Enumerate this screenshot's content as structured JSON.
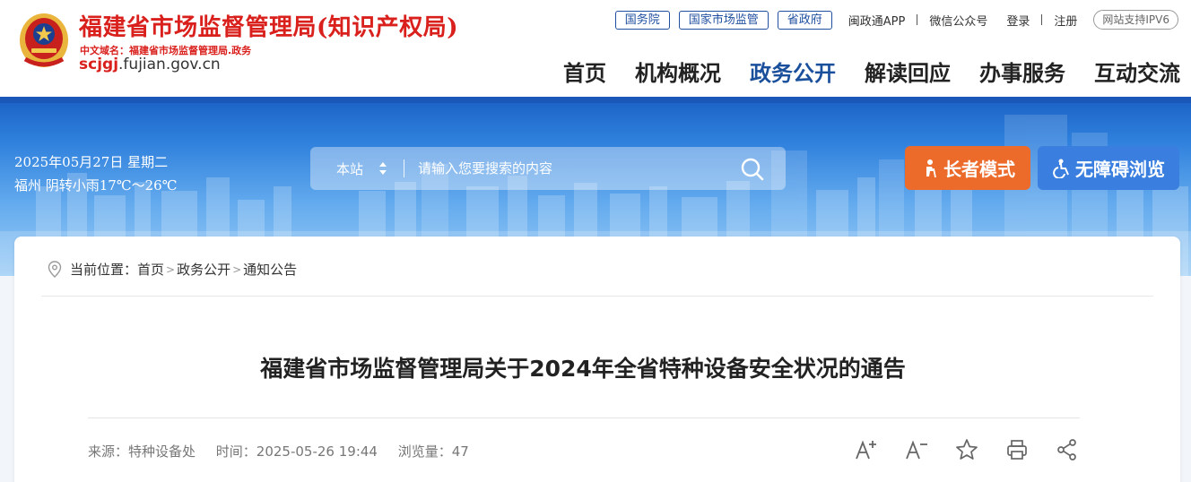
{
  "site": {
    "title": "福建省市场监督管理局(知识产权局)",
    "domain_cn": "中文域名：福建省市场监督管理局.政务",
    "domain_en_bold": "scjgj",
    "domain_en_rest": ".fujian.gov.cn"
  },
  "toplinks": {
    "tags": [
      "国务院",
      "国家市场监管",
      "省政府"
    ],
    "app": "闽政通APP",
    "wechat": "微信公众号",
    "login": "登录",
    "register": "注册",
    "ipv6": "网站支持IPV6"
  },
  "nav": {
    "items": [
      "首页",
      "机构概况",
      "政务公开",
      "解读回应",
      "办事服务",
      "互动交流"
    ],
    "active": "政务公开"
  },
  "banner": {
    "date": "2025年05月27日 星期二",
    "weather": "福州 阴转小雨17℃～26℃",
    "search_scope": "本站",
    "search_placeholder": "请输入您要搜索的内容",
    "elder_mode": "长者模式",
    "accessible": "无障碍浏览"
  },
  "colors": {
    "brand_red": "#d9201c",
    "nav_active": "#1a4f9c",
    "elder_orange": "#ec6a2a",
    "access_blue": "#3a7fe0"
  },
  "breadcrumb": {
    "prefix": "当前位置：",
    "items": [
      "首页",
      "政务公开",
      "通知公告"
    ],
    "separator": ">"
  },
  "article": {
    "title": "福建省市场监督管理局关于2024年全省特种设备安全状况的通告",
    "source": "来源：特种设备处",
    "time": "时间：2025-05-26 19:44",
    "views": "浏览量：47"
  },
  "tools": [
    "font-increase-icon",
    "font-decrease-icon",
    "star-icon",
    "print-icon",
    "share-icon"
  ]
}
